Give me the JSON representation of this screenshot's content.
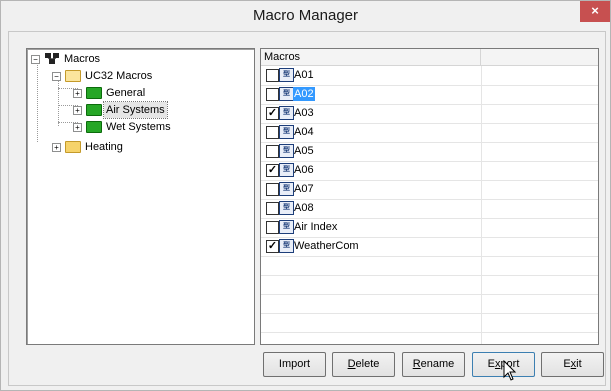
{
  "window": {
    "title": "Macro Manager",
    "close_glyph": "×"
  },
  "tree": {
    "root": "Macros",
    "nodes": [
      {
        "label": "UC32 Macros",
        "expander": "−"
      },
      {
        "label": "General",
        "expander": "+"
      },
      {
        "label": "Air Systems",
        "expander": "+"
      },
      {
        "label": "Wet Systems",
        "expander": "+"
      },
      {
        "label": "Heating",
        "expander": "+"
      }
    ],
    "root_expander": "−"
  },
  "list": {
    "columns": [
      "Macros",
      ""
    ],
    "rows": [
      {
        "label": "A01",
        "checked": false,
        "check_glyph": ""
      },
      {
        "label": "A02",
        "checked": false,
        "check_glyph": "",
        "highlighted": true
      },
      {
        "label": "A03",
        "checked": true,
        "check_glyph": "✓"
      },
      {
        "label": "A04",
        "checked": false,
        "check_glyph": ""
      },
      {
        "label": "A05",
        "checked": false,
        "check_glyph": ""
      },
      {
        "label": "A06",
        "checked": true,
        "check_glyph": "✓"
      },
      {
        "label": "A07",
        "checked": false,
        "check_glyph": ""
      },
      {
        "label": "A08",
        "checked": false,
        "check_glyph": ""
      },
      {
        "label": "Air Index",
        "checked": false,
        "check_glyph": ""
      },
      {
        "label": "WeatherCom",
        "checked": true,
        "check_glyph": "✓"
      }
    ],
    "macro_icon_glyph": "型"
  },
  "buttons": {
    "import": "Import",
    "delete_u": "D",
    "delete_rest": "elete",
    "rename_u": "R",
    "rename_rest": "ename",
    "export_pre": "E",
    "export_u": "x",
    "export_rest": "port",
    "exit_pre": "E",
    "exit_u": "x",
    "exit_rest": "it"
  },
  "colors": {
    "accent": "#3399ff",
    "close": "#c75050",
    "folder_green": "#26a626",
    "folder_yellow": "#f6d36a"
  }
}
